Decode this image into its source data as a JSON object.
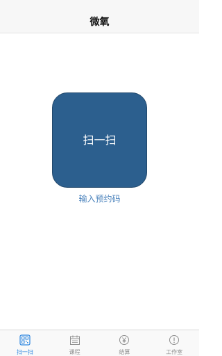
{
  "navbar": {
    "title": "微氧"
  },
  "main": {
    "scan_button_label": "扫一扫",
    "reservation_link": "输入预约码"
  },
  "tabbar": {
    "active_index": 0,
    "active_color": "#2d86e0",
    "inactive_color": "#8e8e8e",
    "items": [
      {
        "label": "扫一扫",
        "icon": "qr-code-icon"
      },
      {
        "label": "课程",
        "icon": "calendar-icon"
      },
      {
        "label": "结算",
        "icon": "yen-circle-icon"
      },
      {
        "label": "工作室",
        "icon": "info-circle-icon"
      }
    ]
  },
  "colors": {
    "scan_button": "#2c5f8e",
    "link": "#4a82bc"
  }
}
